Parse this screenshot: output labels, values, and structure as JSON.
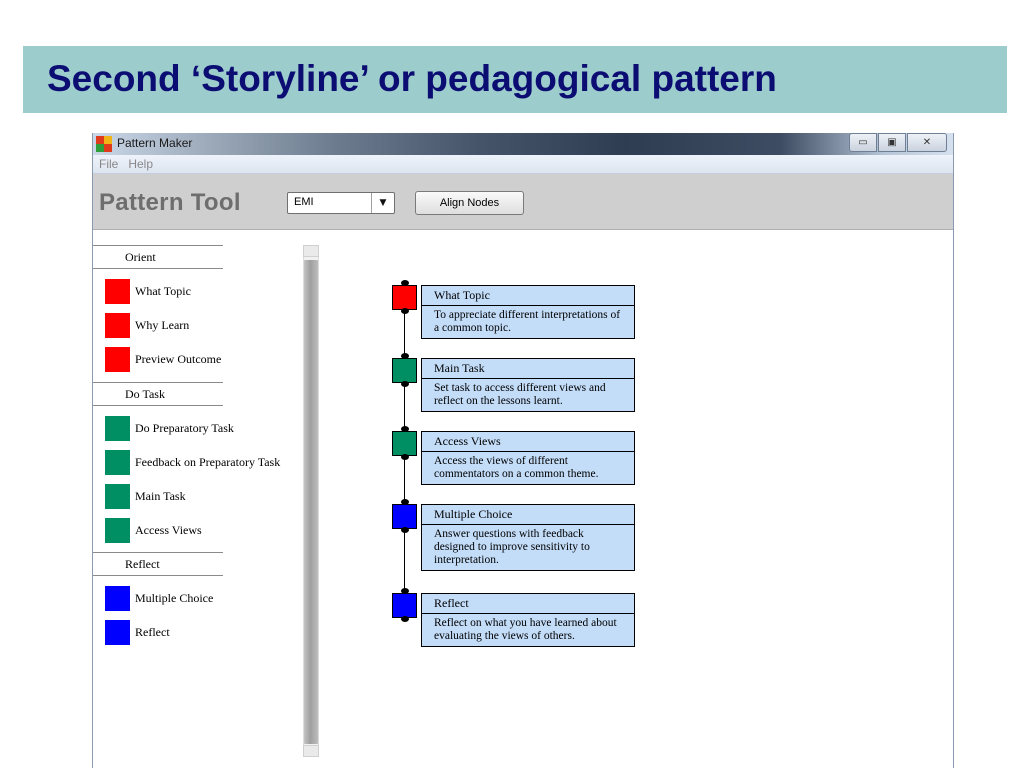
{
  "slide": {
    "title": "Second ‘Storyline’ or pedagogical pattern"
  },
  "window": {
    "title": "Pattern Maker",
    "controls": {
      "minimize": "▭",
      "maximize": "▣",
      "close": "✕"
    }
  },
  "menu": {
    "file": "File",
    "help": "Help"
  },
  "toolbar": {
    "title": "Pattern Tool",
    "dropdown_value": "EMI",
    "dropdown_arrow": "▼",
    "align_label": "Align Nodes"
  },
  "colors": {
    "red": "#ff0000",
    "green": "#008f63",
    "blue": "#0000ff",
    "node_fill": "#c3dcf8"
  },
  "palette": {
    "groups": [
      {
        "heading": "Orient",
        "items": [
          {
            "label": "What Topic",
            "color": "red"
          },
          {
            "label": "Why Learn",
            "color": "red"
          },
          {
            "label": "Preview Outcome",
            "color": "red"
          }
        ]
      },
      {
        "heading": "Do Task",
        "items": [
          {
            "label": "Do Preparatory Task",
            "color": "green"
          },
          {
            "label": "Feedback on Preparatory Task",
            "color": "green"
          },
          {
            "label": "Main Task",
            "color": "green"
          },
          {
            "label": "Access Views",
            "color": "green"
          }
        ]
      },
      {
        "heading": "Reflect",
        "items": [
          {
            "label": "Multiple Choice",
            "color": "blue"
          },
          {
            "label": "Reflect",
            "color": "blue"
          }
        ]
      }
    ]
  },
  "nodes": [
    {
      "title": "What Topic",
      "desc": "To appreciate different interpretations of a common topic.",
      "color": "red"
    },
    {
      "title": "Main Task",
      "desc": "Set task to access different views and reflect on the lessons learnt.",
      "color": "green"
    },
    {
      "title": "Access Views",
      "desc": "Access the views of different commentators on a common theme.",
      "color": "green"
    },
    {
      "title": "Multiple Choice",
      "desc": "Answer questions with feedback designed to improve sensitivity to interpretation.",
      "color": "blue"
    },
    {
      "title": "Reflect",
      "desc": "Reflect on what you have learned about evaluating the views of others.",
      "color": "blue"
    }
  ]
}
